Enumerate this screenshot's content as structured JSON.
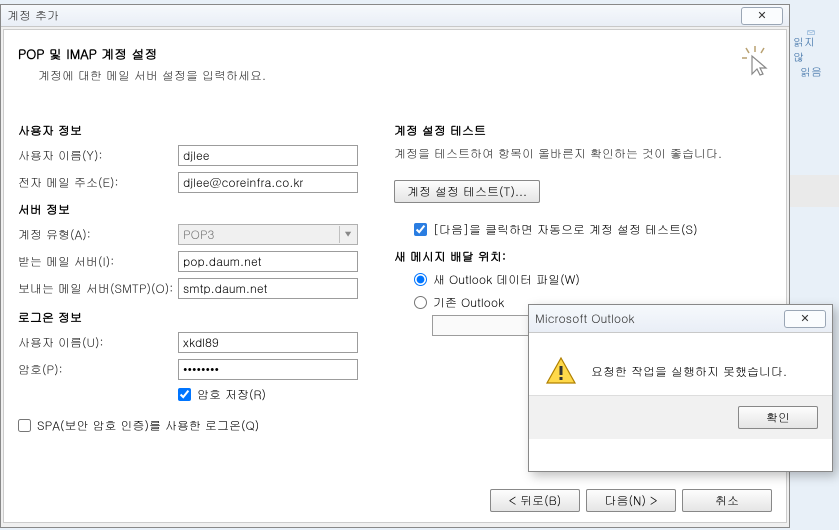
{
  "window": {
    "title": "계정 추가",
    "close_glyph": "✕"
  },
  "header": {
    "title": "POP 및 IMAP 계정 설정",
    "subtitle": "계정에 대한 메일 서버 설정을 입력하세요."
  },
  "sections": {
    "user_info": "사용자 정보",
    "server_info": "서버 정보",
    "logon_info": "로그온 정보",
    "test_title": "계정 설정 테스트",
    "test_desc": "계정을 테스트하여 항목이 올바른지 확인하는 것이 좋습니다.",
    "delivery_title": "새 메시지 배달 위치:"
  },
  "labels": {
    "username_y": "사용자 이름(Y):",
    "email_e": "전자 메일 주소(E):",
    "account_type_a": "계정 유형(A):",
    "incoming_i": "받는 메일 서버(I):",
    "outgoing_o": "보내는 메일 서버(SMTP)(O):",
    "username_u": "사용자 이름(U):",
    "password_p": "암호(P):",
    "remember_pw": "암호 저장(R)",
    "spa": "SPA(보안 암호 인증)를 사용한 로그온(Q)",
    "test_btn": "계정 설정 테스트(T)...",
    "autotest": "[다음]을 클릭하면 자동으로 계정 설정 테스트(S)",
    "new_file": "새 Outlook 데이터 파일(W)",
    "existing_file": "기존 Outlook"
  },
  "values": {
    "username_y": "djlee",
    "email": "djlee@coreinfra.co.kr",
    "account_type": "POP3",
    "incoming": "pop.daum.net",
    "outgoing": "smtp.daum.net",
    "username_u": "xkdl89",
    "password": "********"
  },
  "footer": {
    "back": "< 뒤로(B)",
    "next": "다음(N) >",
    "cancel": "취소"
  },
  "popup": {
    "title": "Microsoft Outlook",
    "message": "요청한 작업을 실행하지 못했습니다.",
    "ok": "확인",
    "close_glyph": "✕"
  },
  "ribbon": {
    "line1": "읽지 않",
    "line2": "읽음"
  }
}
